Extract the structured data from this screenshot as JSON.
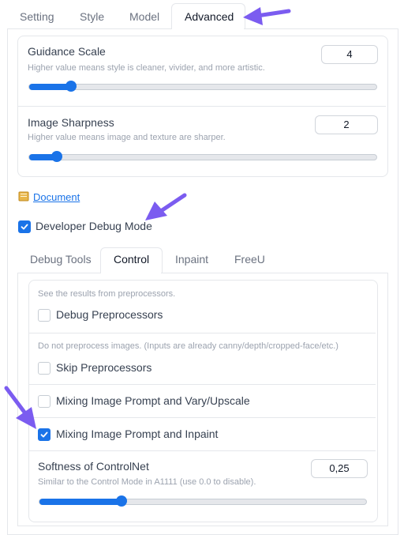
{
  "top_tabs": [
    "Setting",
    "Style",
    "Model",
    "Advanced"
  ],
  "advanced": {
    "guidance": {
      "label": "Guidance Scale",
      "desc": "Higher value means style is cleaner, vivider, and more artistic.",
      "value": "4",
      "slider_fraction": 0.12
    },
    "sharpness": {
      "label": "Image Sharpness",
      "desc": "Higher value means image and texture are sharper.",
      "value": "2",
      "slider_fraction": 0.08
    },
    "document_link": "Document",
    "debug_mode_label": "Developer Debug Mode",
    "debug_mode_checked": true
  },
  "sub_tabs": [
    "Debug Tools",
    "Control",
    "Inpaint",
    "FreeU"
  ],
  "control": {
    "preproc_hint": "See the results from preprocessors.",
    "debug_preproc_label": "Debug Preprocessors",
    "skip_hint": "Do not preprocess images. (Inputs are already canny/depth/cropped-face/etc.)",
    "skip_preproc_label": "Skip Preprocessors",
    "mix_vary_label": "Mixing Image Prompt and Vary/Upscale",
    "mix_inpaint_label": "Mixing Image Prompt and Inpaint",
    "softness": {
      "label": "Softness of ControlNet",
      "desc": "Similar to the Control Mode in A1111 (use 0.0 to disable).",
      "value": "0,25",
      "slider_fraction": 0.25
    }
  },
  "colors": {
    "accent": "#1a73e8",
    "annotation_arrow": "#7b5cf0"
  }
}
